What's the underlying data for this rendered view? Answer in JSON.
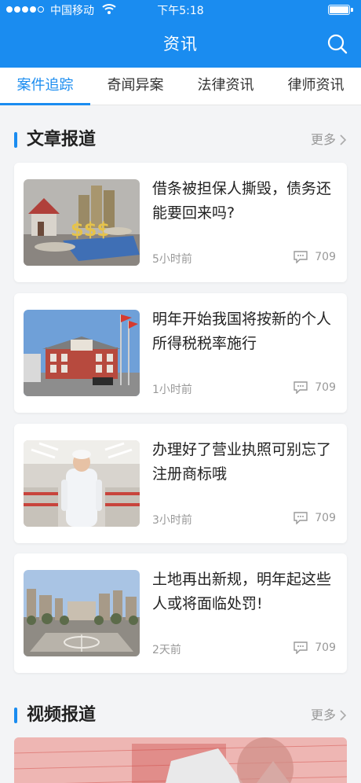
{
  "status_bar": {
    "carrier": "中国移动",
    "time": "下午5:18"
  },
  "header": {
    "title": "资讯"
  },
  "tabs": [
    {
      "label": "案件追踪"
    },
    {
      "label": "奇闻异案"
    },
    {
      "label": "法律资讯"
    },
    {
      "label": "律师资讯"
    }
  ],
  "active_tab": "案件追踪",
  "articles_section": {
    "title": "文章报道",
    "more": "更多"
  },
  "articles": [
    {
      "title": "借条被担保人撕毁，债务还能要回来吗?",
      "time": "5小时前",
      "comments": "709"
    },
    {
      "title": "明年开始我国将按新的个人所得税税率施行",
      "time": "1小时前",
      "comments": "709"
    },
    {
      "title": "办理好了营业执照可别忘了注册商标哦",
      "time": "3小时前",
      "comments": "709"
    },
    {
      "title": "土地再出新规，明年起这些人或将面临处罚!",
      "time": "2天前",
      "comments": "709"
    }
  ],
  "videos_section": {
    "title": "视频报道",
    "more": "更多"
  },
  "colors": {
    "accent": "#1a8cf0",
    "muted": "#999999"
  }
}
